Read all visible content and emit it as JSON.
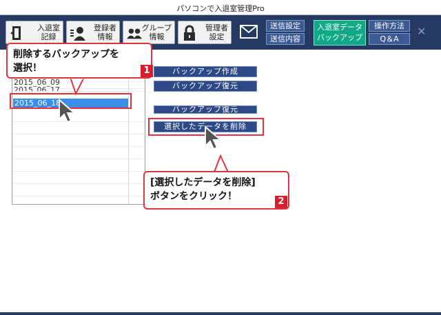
{
  "window": {
    "title": "パソコンで入退室管理Pro"
  },
  "toolbar": {
    "entry_record": {
      "line1": "入退室",
      "line2": "記録"
    },
    "registrant_info": {
      "line1": "登録者",
      "line2": "情報"
    },
    "group_info": {
      "line1": "グループ",
      "line2": "情報"
    },
    "admin_settings": {
      "line1": "管理者",
      "line2": "設定"
    },
    "send_settings": "送信設定",
    "send_content": "送信内容",
    "backup": {
      "line1": "入退室データ",
      "line2": "バックアップ"
    },
    "how_to": "操作方法",
    "qa": "Q＆A",
    "close": "✕"
  },
  "backup_list": {
    "items": [
      "2015_06_09",
      "2015_06_17"
    ],
    "selected": "2015_06_18"
  },
  "actions": {
    "create_backup": "バックアップ作成",
    "restore_backup": "バックアップ復元",
    "restore_backup_2": "バックアップ復元",
    "delete_selected": "選択したデータを削除"
  },
  "callouts": {
    "step1": {
      "line1": "削除するバックアップを",
      "line2": "選択！",
      "num": "1"
    },
    "step2": {
      "line1": "[選択したデータを削除]",
      "line2": "ボタンをクリック！",
      "num": "2"
    }
  }
}
